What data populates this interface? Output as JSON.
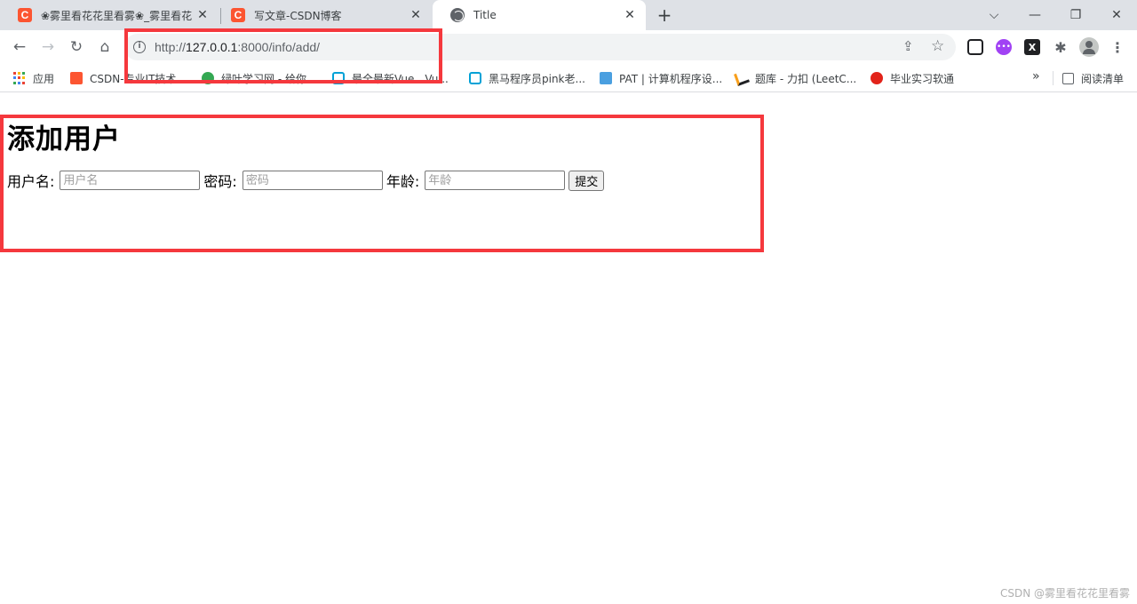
{
  "tabs": [
    {
      "title": "❀雾里看花花里看雾❀_雾里看花",
      "icon": "csdn-icon",
      "active": false
    },
    {
      "title": "写文章-CSDN博客",
      "icon": "csdn-icon",
      "active": false
    },
    {
      "title": "Title",
      "icon": "globe-icon",
      "active": true
    }
  ],
  "tab_glyphs": {
    "close": "✕",
    "new": "+",
    "c": "C"
  },
  "window_controls": {
    "dropdown": "⌵",
    "minimize": "—",
    "restore": "❐",
    "close": "✕"
  },
  "toolbar": {
    "back": "←",
    "forward": "→",
    "reload": "↻",
    "home": "⌂",
    "url_scheme": "http://",
    "url_host": "127.0.0.1",
    "url_rest": ":8000/info/add/",
    "info_glyph": "i",
    "share_glyph": "⇪",
    "star_glyph": "☆",
    "menu_glyph": "⋮",
    "ext3_glyph": "X",
    "ext2_glyph": "•••",
    "puzzle_glyph": "✱"
  },
  "bookmarks": [
    {
      "label": "应用",
      "icon": "apps-icon"
    },
    {
      "label": "CSDN-专业IT技术...",
      "icon": "csdn-icon"
    },
    {
      "label": "绿叶学习网 - 给你...",
      "icon": "leaf-icon"
    },
    {
      "label": "最全最新Vue、Vu...",
      "icon": "bilibili-icon"
    },
    {
      "label": "黑马程序员pink老...",
      "icon": "bilibili-icon"
    },
    {
      "label": "PAT | 计算机程序设...",
      "icon": "pat-icon"
    },
    {
      "label": "题库 - 力扣 (LeetC...",
      "icon": "leetcode-icon"
    },
    {
      "label": "毕业实习软通",
      "icon": "bookmark-icon"
    }
  ],
  "bookmarks_more": "»",
  "reading_list": "阅读清单",
  "page": {
    "title": "添加用户",
    "form": {
      "username_label": "用户名:",
      "username_placeholder": "用户名",
      "password_label": "密码:",
      "password_placeholder": "密码",
      "age_label": "年龄:",
      "age_placeholder": "年龄",
      "submit_label": "提交"
    }
  },
  "watermark": "CSDN @雾里看花花里看雾",
  "colors": {
    "highlight": "#f5383d",
    "tabstrip": "#dee1e6",
    "csdn": "#fc5531"
  }
}
